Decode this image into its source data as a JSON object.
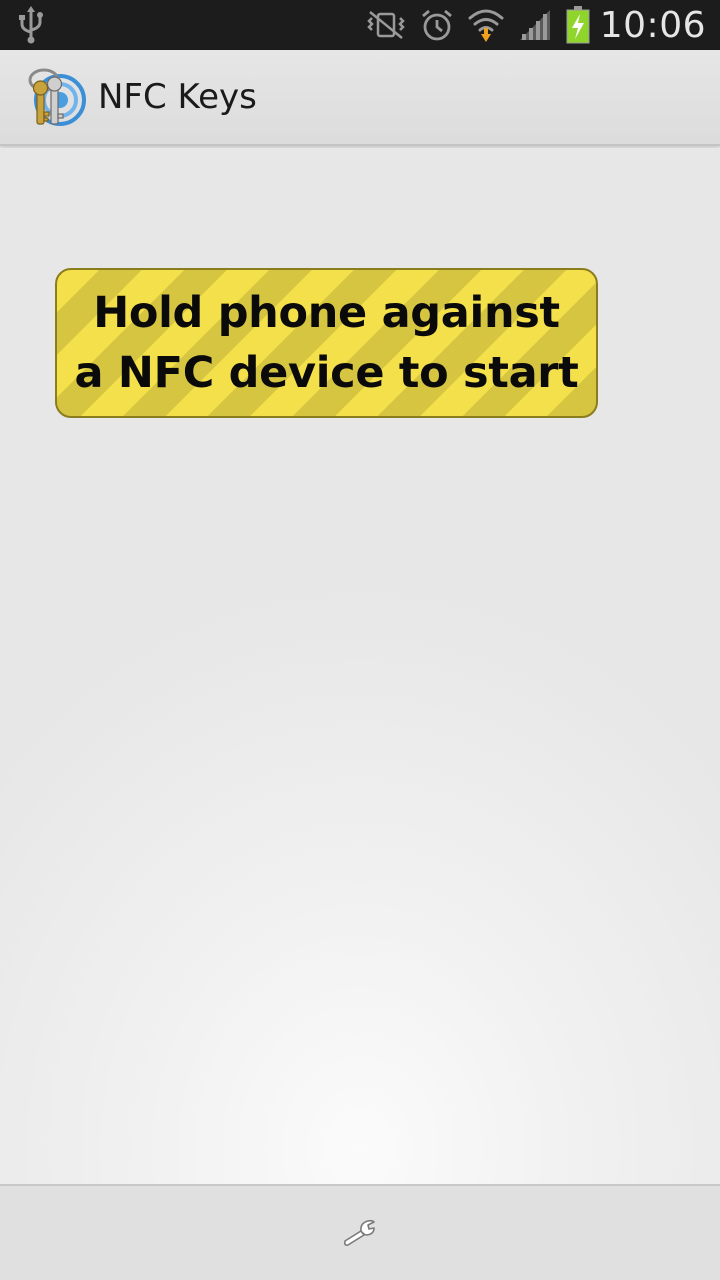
{
  "status_bar": {
    "time": "10:06",
    "icons": [
      "usb-icon",
      "vibrate-mute-icon",
      "alarm-icon",
      "wifi-icon",
      "signal-icon",
      "battery-charging-icon"
    ],
    "battery_color": "#8fd52c"
  },
  "action_bar": {
    "title": "NFC Keys",
    "icon": "keys-app-icon"
  },
  "banner": {
    "line1": "Hold phone against",
    "line2": "a NFC device to start",
    "stripe_color_light": "#f4e04a",
    "stripe_color_dark": "#d6c540"
  },
  "bottom_bar": {
    "icon": "wrench-icon"
  }
}
